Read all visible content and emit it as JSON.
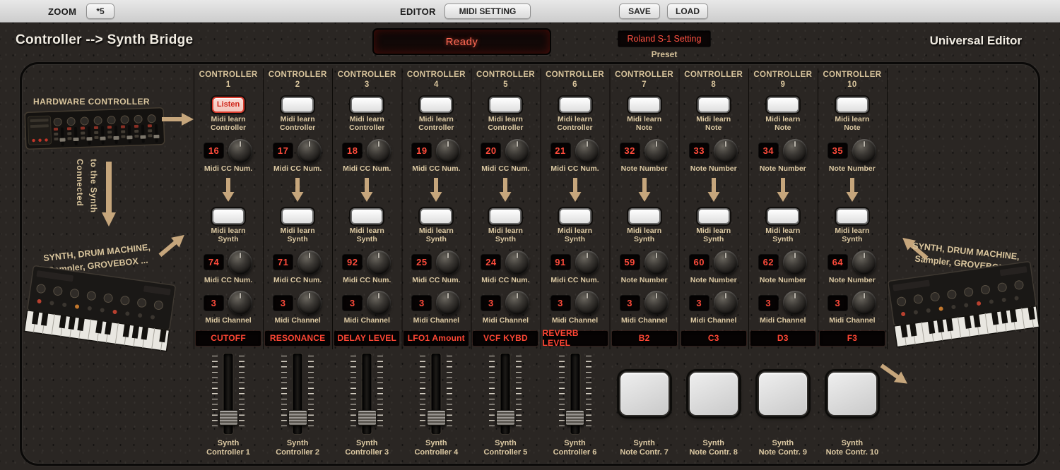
{
  "toolbar": {
    "zoom_label": "ZOOM",
    "zoom_button": "*5",
    "editor_label": "EDITOR",
    "midi_setting_button": "MIDI SETTING",
    "save_button": "SAVE",
    "load_button": "LOAD"
  },
  "header": {
    "title": "Controller --> Synth Bridge",
    "lcd_text": "Ready",
    "preset_value": "Roland S-1 Setting",
    "preset_label": "Preset",
    "app_title": "Universal Editor"
  },
  "left_panel": {
    "hardware_label": "HARDWARE CONTROLLER",
    "connected_label": "Connected\nto the Synth",
    "synth_caption": "SYNTH, DRUM MACHINE,\nSampler, GROVEBOX ..."
  },
  "right_panel": {
    "synth_caption": "SYNTH, DRUM MACHINE,\nSampler, GROVEBOX ..."
  },
  "colors": {
    "accent_red": "#ff4634",
    "label_tan": "#dcc9a3",
    "arrow_tan": "#c6a67c"
  },
  "columns": [
    {
      "header": "CONTROLLER",
      "number": "1",
      "learn_button": "Listen",
      "learn_active": true,
      "learn_caption": "Midi learn\nController",
      "in_value": "16",
      "in_caption": "Midi CC Num.",
      "synth_caption": "Midi learn\nSynth",
      "out_value": "74",
      "out_caption": "Midi CC Num.",
      "channel_value": "3",
      "channel_caption": "Midi Channel",
      "param": "CUTOFF",
      "bottom_label": "Synth\nController 1",
      "type": "slider"
    },
    {
      "header": "CONTROLLER",
      "number": "2",
      "learn_button": "",
      "learn_active": false,
      "learn_caption": "Midi learn\nController",
      "in_value": "17",
      "in_caption": "Midi CC Num.",
      "synth_caption": "Midi learn\nSynth",
      "out_value": "71",
      "out_caption": "Midi CC Num.",
      "channel_value": "3",
      "channel_caption": "Midi Channel",
      "param": "RESONANCE",
      "bottom_label": "Synth\nController 2",
      "type": "slider"
    },
    {
      "header": "CONTROLLER",
      "number": "3",
      "learn_button": "",
      "learn_active": false,
      "learn_caption": "Midi learn\nController",
      "in_value": "18",
      "in_caption": "Midi CC Num.",
      "synth_caption": "Midi learn\nSynth",
      "out_value": "92",
      "out_caption": "Midi CC Num.",
      "channel_value": "3",
      "channel_caption": "Midi Channel",
      "param": "DELAY LEVEL",
      "bottom_label": "Synth\nController 3",
      "type": "slider"
    },
    {
      "header": "CONTROLLER",
      "number": "4",
      "learn_button": "",
      "learn_active": false,
      "learn_caption": "Midi learn\nController",
      "in_value": "19",
      "in_caption": "Midi CC Num.",
      "synth_caption": "Midi learn\nSynth",
      "out_value": "25",
      "out_caption": "Midi CC Num.",
      "channel_value": "3",
      "channel_caption": "Midi Channel",
      "param": "LFO1 Amount",
      "bottom_label": "Synth\nController 4",
      "type": "slider"
    },
    {
      "header": "CONTROLLER",
      "number": "5",
      "learn_button": "",
      "learn_active": false,
      "learn_caption": "Midi learn\nController",
      "in_value": "20",
      "in_caption": "Midi CC Num.",
      "synth_caption": "Midi learn\nSynth",
      "out_value": "24",
      "out_caption": "Midi CC Num.",
      "channel_value": "3",
      "channel_caption": "Midi Channel",
      "param": "VCF KYBD",
      "bottom_label": "Synth\nController 5",
      "type": "slider"
    },
    {
      "header": "CONTROLLER",
      "number": "6",
      "learn_button": "",
      "learn_active": false,
      "learn_caption": "Midi learn\nController",
      "in_value": "21",
      "in_caption": "Midi CC Num.",
      "synth_caption": "Midi learn\nSynth",
      "out_value": "91",
      "out_caption": "Midi CC Num.",
      "channel_value": "3",
      "channel_caption": "Midi Channel",
      "param": "REVERB LEVEL",
      "bottom_label": "Synth\nController 6",
      "type": "slider"
    },
    {
      "header": "CONTROLLER",
      "number": "7",
      "learn_button": "",
      "learn_active": false,
      "learn_caption": "Midi learn\nNote",
      "in_value": "32",
      "in_caption": "Note Number",
      "synth_caption": "Midi learn\nSynth",
      "out_value": "59",
      "out_caption": "Note Number",
      "channel_value": "3",
      "channel_caption": "Midi Channel",
      "param": "B2",
      "bottom_label": "Synth\nNote Contr. 7",
      "type": "pad"
    },
    {
      "header": "CONTROLLER",
      "number": "8",
      "learn_button": "",
      "learn_active": false,
      "learn_caption": "Midi learn\nNote",
      "in_value": "33",
      "in_caption": "Note Number",
      "synth_caption": "Midi learn\nSynth",
      "out_value": "60",
      "out_caption": "Note Number",
      "channel_value": "3",
      "channel_caption": "Midi Channel",
      "param": "C3",
      "bottom_label": "Synth\nNote Contr. 8",
      "type": "pad"
    },
    {
      "header": "CONTROLLER",
      "number": "9",
      "learn_button": "",
      "learn_active": false,
      "learn_caption": "Midi learn\nNote",
      "in_value": "34",
      "in_caption": "Note Number",
      "synth_caption": "Midi learn\nSynth",
      "out_value": "62",
      "out_caption": "Note Number",
      "channel_value": "3",
      "channel_caption": "Midi Channel",
      "param": "D3",
      "bottom_label": "Synth\nNote Contr. 9",
      "type": "pad"
    },
    {
      "header": "CONTROLLER",
      "number": "10",
      "learn_button": "",
      "learn_active": false,
      "learn_caption": "Midi learn\nNote",
      "in_value": "35",
      "in_caption": "Note Number",
      "synth_caption": "Midi learn\nSynth",
      "out_value": "64",
      "out_caption": "Note Number",
      "channel_value": "3",
      "channel_caption": "Midi Channel",
      "param": "F3",
      "bottom_label": "Synth\nNote Contr. 10",
      "type": "pad"
    }
  ]
}
